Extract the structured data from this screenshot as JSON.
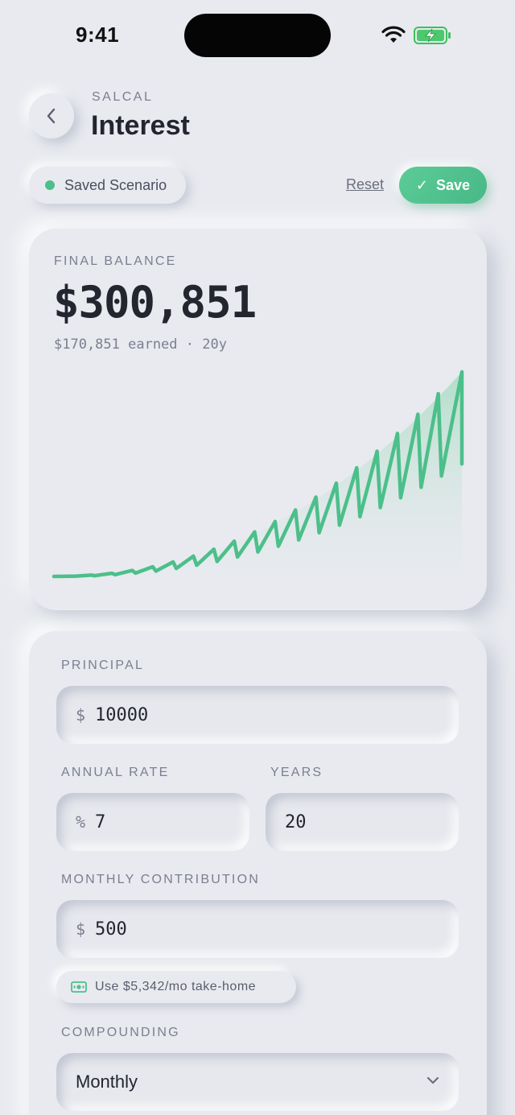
{
  "status_bar": {
    "time": "9:41"
  },
  "header": {
    "app_label": "SALCAL",
    "title": "Interest"
  },
  "actions": {
    "scenario_label": "Saved Scenario",
    "reset_label": "Reset",
    "save_label": "Save"
  },
  "balance": {
    "label": "FINAL BALANCE",
    "value": "$300,851",
    "subtitle": "$170,851 earned · 20y"
  },
  "chart_data": {
    "type": "line",
    "x": [
      0,
      20
    ],
    "values": "compounded monthly balance with oscillating contribution pattern",
    "title": "",
    "xlabel": "",
    "ylabel": "",
    "grid": false,
    "colors": {
      "line": "#4cbf8a",
      "fill": "#a8dcc2"
    }
  },
  "form": {
    "principal": {
      "label": "PRINCIPAL",
      "prefix": "$",
      "value": "10000"
    },
    "annual_rate": {
      "label": "ANNUAL RATE",
      "prefix": "%",
      "value": "7"
    },
    "years": {
      "label": "YEARS",
      "value": "20"
    },
    "monthly_contribution": {
      "label": "MONTHLY CONTRIBUTION",
      "prefix": "$",
      "value": "500"
    },
    "takehome_chip": {
      "label": "Use $5,342/mo take-home",
      "icon": "cash-icon"
    },
    "compounding": {
      "label": "COMPOUNDING",
      "value": "Monthly"
    }
  },
  "colors": {
    "accent": "#4cbf8a",
    "background": "#e8eaef",
    "text": "#23252f",
    "muted": "#7b7f8f"
  }
}
